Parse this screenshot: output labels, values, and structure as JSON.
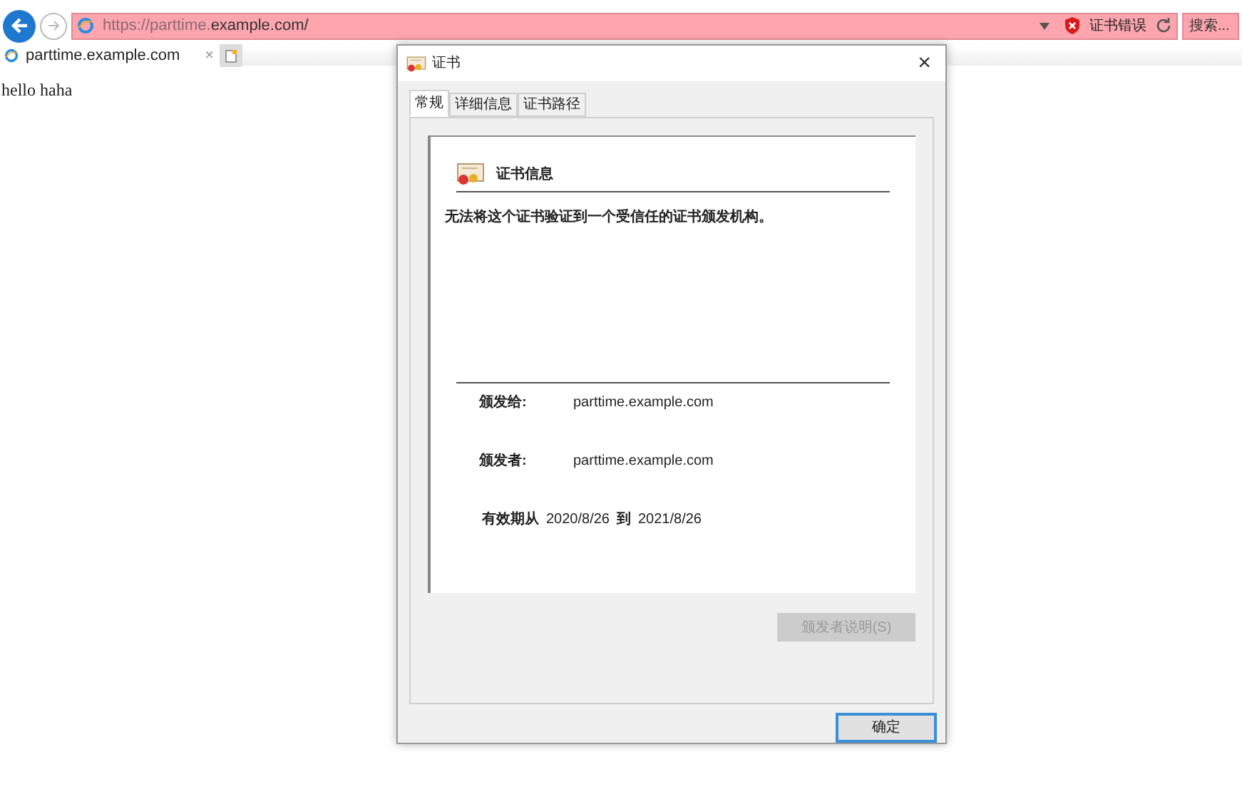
{
  "browser": {
    "url_dim": "https://parttime.",
    "url_main": "example.com/",
    "cert_error": "证书错误",
    "search_placeholder": "搜索...",
    "tab": {
      "label": "parttime.example.com",
      "close": "×",
      "selected": true
    }
  },
  "page": {
    "text": "hello haha"
  },
  "dialog": {
    "title": "证书",
    "close": "×",
    "tabs": [
      {
        "label": "常规",
        "selected": true
      },
      {
        "label": "详细信息",
        "selected": false
      },
      {
        "label": "证书路径",
        "selected": false
      }
    ],
    "info_heading": "证书信息",
    "message": "无法将这个证书验证到一个受信任的证书颁发机构。",
    "fields": [
      {
        "label": "颁发给:",
        "value": "parttime.example.com"
      },
      {
        "label": "颁发者:",
        "value": "parttime.example.com"
      }
    ],
    "validity": {
      "from_label": "有效期从",
      "from": "2020/8/26",
      "to_label": "到",
      "to": "2021/8/26"
    },
    "issuer_button": {
      "label": "颁发者说明(S)",
      "disabled": true
    },
    "ok_button": "确定"
  }
}
